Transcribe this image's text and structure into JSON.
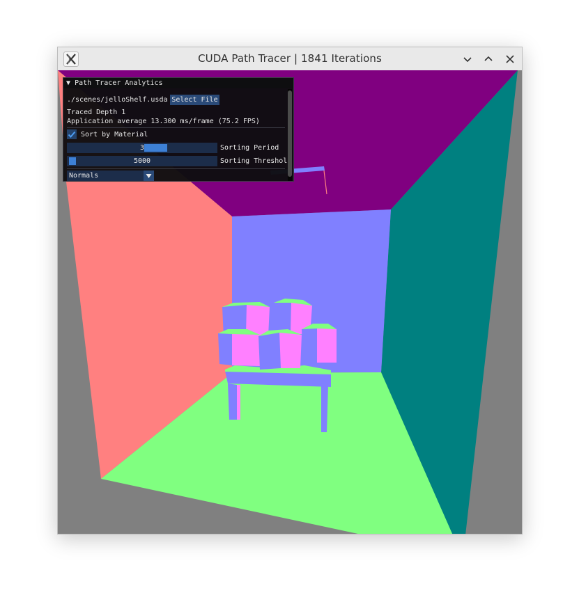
{
  "window": {
    "title": "CUDA Path Tracer | 1841 Iterations",
    "app_icon": "x-logo-icon",
    "controls": [
      "minimize-chevron-down-icon",
      "maximize-chevron-up-icon",
      "close-icon"
    ]
  },
  "panel": {
    "title": "Path Tracer Analytics",
    "file_path": "./scenes/jelloShelf.usda",
    "select_file_label": "Select File",
    "traced_depth": "Traced Depth 1",
    "app_average": "Application average 13.300 ms/frame (75.2 FPS)",
    "sort_by_material": {
      "label": "Sort by Material",
      "checked": true
    },
    "sorting_period": {
      "value": "3",
      "label": "Sorting Period"
    },
    "sorting_threshold": {
      "value": "5000",
      "label": "Sorting Threshol"
    },
    "display_mode": {
      "selected": "Normals"
    }
  },
  "scene": {
    "colors": {
      "background": "#808080",
      "left_wall": "#ff8080",
      "right_wall": "#008080",
      "ceiling": "#800080",
      "back_wall": "#8080ff",
      "floor": "#80ff80"
    }
  }
}
